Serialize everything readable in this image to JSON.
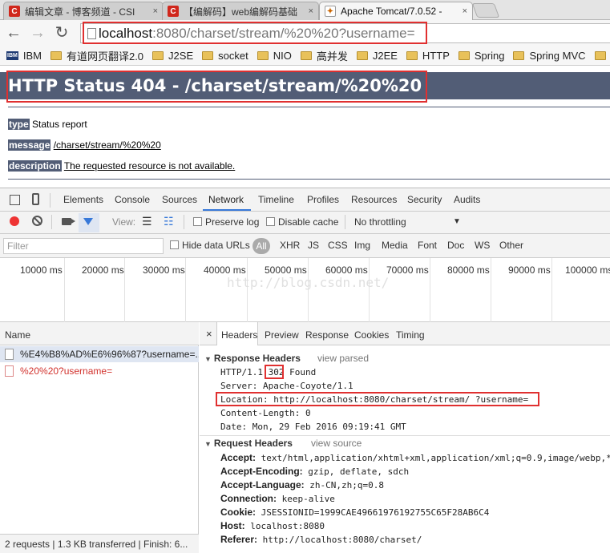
{
  "tabs": [
    {
      "icon": "C",
      "title": "编辑文章 - 博客频道 - CSI",
      "close": "×"
    },
    {
      "icon": "C",
      "title": "【编解码】web编解码基础",
      "close": "×"
    },
    {
      "icon": "tomcat",
      "title": "Apache Tomcat/7.0.52 -",
      "close": "×"
    }
  ],
  "address": {
    "host": "localhost",
    "rest": ":8080/charset/stream/%20%20?username="
  },
  "nav": {
    "back": "←",
    "forward": "→",
    "reload": "↻"
  },
  "bookmarks": [
    {
      "label": "IBM",
      "type": "ibm"
    },
    {
      "label": "有道网页翻译2.0",
      "type": "folder"
    },
    {
      "label": "J2SE",
      "type": "folder"
    },
    {
      "label": "socket",
      "type": "folder"
    },
    {
      "label": "NIO",
      "type": "folder"
    },
    {
      "label": "高并发",
      "type": "folder"
    },
    {
      "label": "J2EE",
      "type": "folder"
    },
    {
      "label": "HTTP",
      "type": "folder"
    },
    {
      "label": "Spring",
      "type": "folder"
    },
    {
      "label": "Spring MVC",
      "type": "folder"
    }
  ],
  "page": {
    "heading": "HTTP Status 404 - /charset/stream/%20%20",
    "type_label": "type",
    "type_value": "Status report",
    "message_label": "message",
    "message_value": "/charset/stream/%20%20",
    "description_label": "description",
    "description_value": "The requested resource is not available."
  },
  "devtools": {
    "tabs": [
      "Elements",
      "Console",
      "Sources",
      "Network",
      "Timeline",
      "Profiles",
      "Resources",
      "Security",
      "Audits"
    ],
    "selected_tab": "Network",
    "toolbar": {
      "view_label": "View:",
      "preserve_log": "Preserve log",
      "disable_cache": "Disable cache",
      "throttle": "No throttling",
      "throttle_arrow": "▼"
    },
    "filter": {
      "placeholder": "Filter",
      "hide_data_urls": "Hide data URLs",
      "all": "All",
      "types": [
        "XHR",
        "JS",
        "CSS",
        "Img",
        "Media",
        "Font",
        "Doc",
        "WS",
        "Other"
      ]
    },
    "timeline_ticks": [
      "10000 ms",
      "20000 ms",
      "30000 ms",
      "40000 ms",
      "50000 ms",
      "60000 ms",
      "70000 ms",
      "80000 ms",
      "90000 ms",
      "100000 ms"
    ],
    "watermark": "http://blog.csdn.net/",
    "name_header": "Name",
    "requests": [
      {
        "name": "%E4%B8%AD%E6%96%87?username=..."
      },
      {
        "name": "%20%20?username="
      }
    ],
    "status_bar": "2 requests  |  1.3 KB transferred  |  Finish: 6...",
    "detail_tabs": [
      "Headers",
      "Preview",
      "Response",
      "Cookies",
      "Timing"
    ],
    "detail_close": "×",
    "response_headers": {
      "title": "Response Headers",
      "view": "view parsed",
      "status_prefix": "HTTP/1.1 ",
      "status_code": "302",
      "status_suffix": " Found",
      "server": "Server: Apache-Coyote/1.1",
      "location": "Location: http://localhost:8080/charset/stream/  ?username=",
      "content_length": "Content-Length: 0",
      "date": "Date: Mon, 29 Feb 2016 09:19:41 GMT"
    },
    "request_headers": {
      "title": "Request Headers",
      "view": "view source",
      "items": [
        {
          "k": "Accept:",
          "v": " text/html,application/xhtml+xml,application/xml;q=0.9,image/webp,*/"
        },
        {
          "k": "Accept-Encoding:",
          "v": " gzip, deflate, sdch"
        },
        {
          "k": "Accept-Language:",
          "v": " zh-CN,zh;q=0.8"
        },
        {
          "k": "Connection:",
          "v": " keep-alive"
        },
        {
          "k": "Cookie:",
          "v": " JSESSIONID=1999CAE49661976192755C65F28AB6C4"
        },
        {
          "k": "Host:",
          "v": " localhost:8080"
        },
        {
          "k": "Referer:",
          "v": " http://localhost:8080/charset/"
        }
      ]
    }
  },
  "colors": {
    "tomcat_bar": "#525d76",
    "highlight": "#e03030",
    "network_accent": "#3879d9"
  }
}
